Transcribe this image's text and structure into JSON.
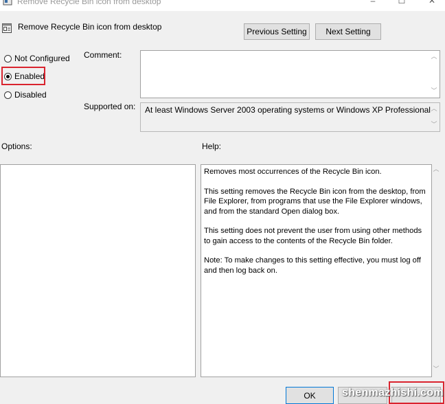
{
  "window": {
    "title": "Remove Recycle Bin icon from desktop",
    "icon": "policy-document-icon",
    "controls": {
      "minimize": "–",
      "maximize": "☐",
      "close": "✕"
    }
  },
  "header": {
    "title": "Remove Recycle Bin icon from desktop",
    "previous_label": "Previous Setting",
    "next_label": "Next Setting"
  },
  "state": {
    "options": [
      {
        "label": "Not Configured",
        "selected": false
      },
      {
        "label": "Enabled",
        "selected": true
      },
      {
        "label": "Disabled",
        "selected": false
      }
    ]
  },
  "comment": {
    "label": "Comment:",
    "value": ""
  },
  "supported": {
    "label": "Supported on:",
    "value": "At least Windows Server 2003 operating systems or Windows XP Professional"
  },
  "options_panel": {
    "label": "Options:"
  },
  "help": {
    "label": "Help:",
    "paragraphs": [
      "Removes most occurrences of the Recycle Bin icon.",
      "This setting removes the Recycle Bin icon from the desktop, from File Explorer, from programs that use the File Explorer windows, and from the standard Open dialog box.",
      "This setting does not prevent the user from using other methods to gain access to the contents of the Recycle Bin folder.",
      "Note: To make changes to this setting effective, you must log off and then log back on."
    ]
  },
  "footer": {
    "ok_label": "OK",
    "cancel_label": "",
    "apply_label": "",
    "watermark": "shenmazhishi.com"
  },
  "colors": {
    "highlight": "#d9232e",
    "ok_border": "#0078d7"
  }
}
